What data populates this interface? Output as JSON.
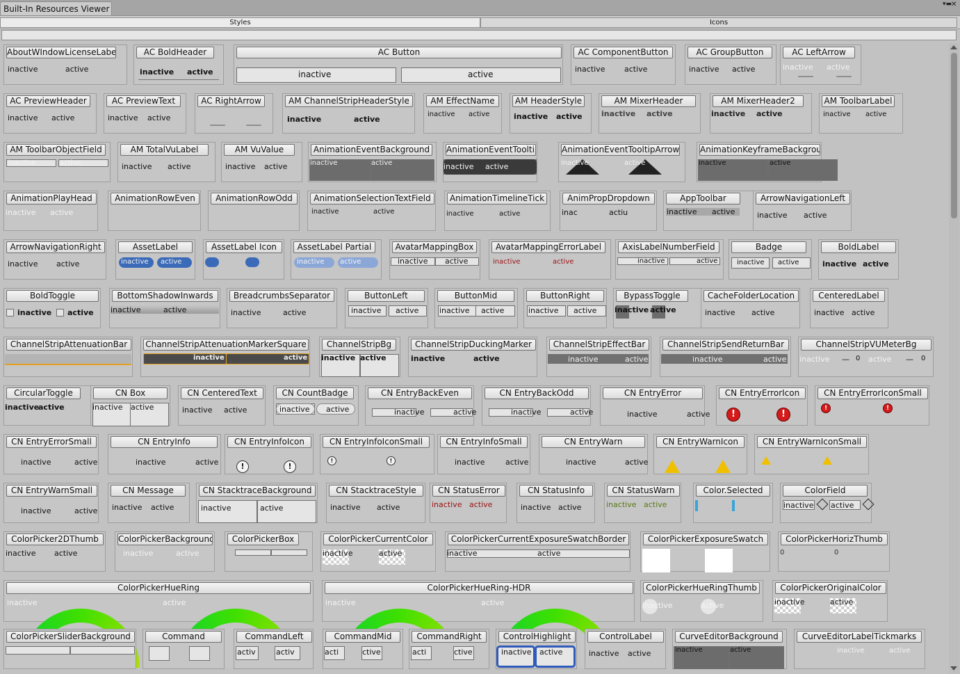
{
  "window": {
    "title": "Built-In Resources Viewer"
  },
  "tabs": {
    "styles": "Styles",
    "icons": "Icons"
  },
  "states": {
    "inactive": "inactive",
    "active": "active"
  },
  "rows": [
    [
      "AboutWIndowLicenseLabel",
      "AC BoldHeader",
      "AC Button",
      "AC ComponentButton",
      "AC GroupButton",
      "AC LeftArrow"
    ],
    [
      "AC PreviewHeader",
      "AC PreviewText",
      "AC RightArrow",
      "AM ChannelStripHeaderStyle",
      "AM EffectName",
      "AM HeaderStyle",
      "AM MixerHeader",
      "AM MixerHeader2",
      "AM ToolbarLabel"
    ],
    [
      "AM ToolbarObjectField",
      "AM TotalVuLabel",
      "AM VuValue",
      "AnimationEventBackground",
      "AnimationEventTooltip",
      "AnimationEventTooltipArrow",
      "AnimationKeyframeBackground"
    ],
    [
      "AnimationPlayHead",
      "AnimationRowEven",
      "AnimationRowOdd",
      "AnimationSelectionTextField",
      "AnimationTimelineTick",
      "AnimPropDropdown",
      "AppToolbar",
      "ArrowNavigationLeft"
    ],
    [
      "ArrowNavigationRight",
      "AssetLabel",
      "AssetLabel Icon",
      "AssetLabel Partial",
      "AvatarMappingBox",
      "AvatarMappingErrorLabel",
      "AxisLabelNumberField",
      "Badge",
      "BoldLabel"
    ],
    [
      "BoldToggle",
      "BottomShadowInwards",
      "BreadcrumbsSeparator",
      "ButtonLeft",
      "ButtonMid",
      "ButtonRight",
      "BypassToggle",
      "CacheFolderLocation",
      "CenteredLabel"
    ],
    [
      "ChannelStripAttenuationBar",
      "ChannelStripAttenuationMarkerSquare",
      "ChannelStripBg",
      "ChannelStripDuckingMarker",
      "ChannelStripEffectBar",
      "ChannelStripSendReturnBar",
      "ChannelStripVUMeterBg"
    ],
    [
      "CircularToggle",
      "CN Box",
      "CN CenteredText",
      "CN CountBadge",
      "CN EntryBackEven",
      "CN EntryBackOdd",
      "CN EntryError",
      "CN EntryErrorIcon",
      "CN EntryErrorIconSmall"
    ],
    [
      "CN EntryErrorSmall",
      "CN EntryInfo",
      "CN EntryInfoIcon",
      "CN EntryInfoIconSmall",
      "CN EntryInfoSmall",
      "CN EntryWarn",
      "CN EntryWarnIcon",
      "CN EntryWarnIconSmall"
    ],
    [
      "CN EntryWarnSmall",
      "CN Message",
      "CN StacktraceBackground",
      "CN StacktraceStyle",
      "CN StatusError",
      "CN StatusInfo",
      "CN StatusWarn",
      "Color.Selected",
      "ColorField"
    ],
    [
      "ColorPicker2DThumb",
      "ColorPickerBackground",
      "ColorPickerBox",
      "ColorPickerCurrentColor",
      "ColorPickerCurrentExposureSwatchBorder",
      "ColorPickerExposureSwatch",
      "ColorPickerHorizThumb"
    ],
    [
      "ColorPickerHueRing",
      "ColorPickerHueRing-HDR",
      "ColorPickerHueRingThumb",
      "ColorPickerOriginalColor"
    ],
    [
      "ColorPickerSliderBackground",
      "Command",
      "CommandLeft",
      "CommandMid",
      "CommandRight",
      "ControlHighlight",
      "ControlLabel",
      "CurveEditorBackground",
      "CurveEditorLabelTickmarks"
    ]
  ],
  "fragments": {
    "inac": "inac",
    "acti": "acti",
    "actiu": "actiu",
    "activ": "activ",
    "ctive": "ctive",
    "0": "0",
    "dash": "—"
  }
}
